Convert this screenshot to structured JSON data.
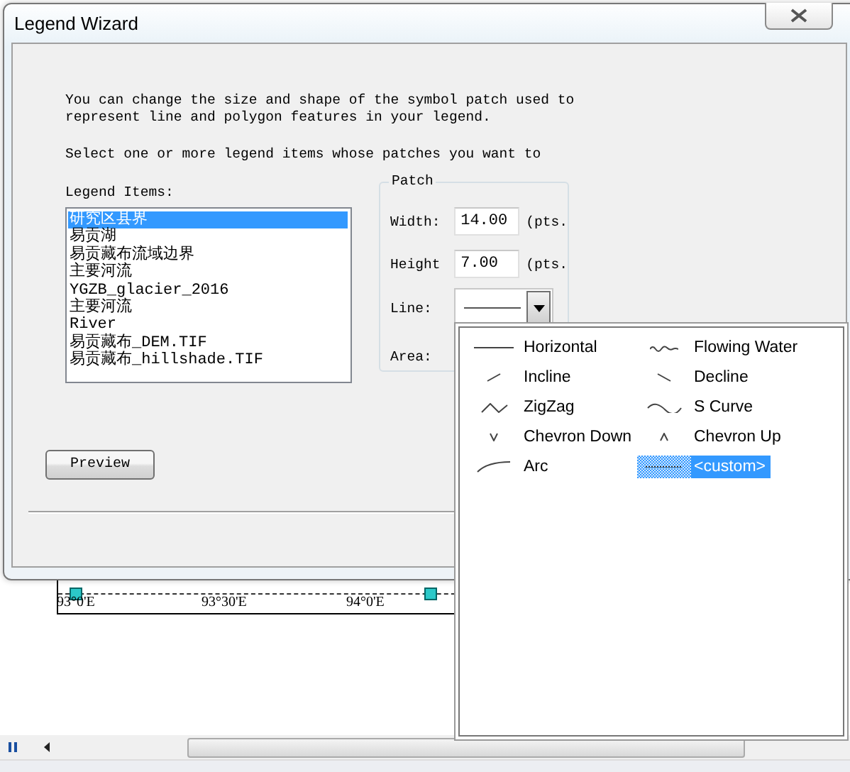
{
  "window": {
    "title": "Legend Wizard"
  },
  "intro_lines": [
    "You can change the size and shape of the symbol patch used to",
    "represent line and polygon features in your legend."
  ],
  "instruction": "Select one or more legend items whose patches you want to",
  "legend_items": {
    "label": "Legend Items:",
    "items": [
      {
        "text": "研究区县界",
        "selected": true
      },
      {
        "text": "易贡湖",
        "selected": false
      },
      {
        "text": "易贡藏布流域边界",
        "selected": false
      },
      {
        "text": "主要河流",
        "selected": false
      },
      {
        "text": "YGZB_glacier_2016",
        "selected": false
      },
      {
        "text": "主要河流",
        "selected": false
      },
      {
        "text": "River",
        "selected": false
      },
      {
        "text": "易贡藏布_DEM.TIF",
        "selected": false
      },
      {
        "text": "易贡藏布_hillshade.TIF",
        "selected": false
      }
    ]
  },
  "patch": {
    "title": "Patch",
    "fields": [
      {
        "label": "Width:",
        "value": "14.00",
        "unit": "(pts."
      },
      {
        "label": "Height",
        "value": "7.00",
        "unit": "(pts."
      }
    ],
    "line_label": "Line:",
    "area_label": "Area:"
  },
  "preview_button": "Preview",
  "line_menu": {
    "items": [
      {
        "label": "Horizontal",
        "kind": "horizontal",
        "selected": false
      },
      {
        "label": "Flowing Water",
        "kind": "flowing",
        "selected": false
      },
      {
        "label": "Incline",
        "kind": "incline",
        "selected": false
      },
      {
        "label": "Decline",
        "kind": "decline",
        "selected": false
      },
      {
        "label": "ZigZag",
        "kind": "zigzag",
        "selected": false
      },
      {
        "label": "S Curve",
        "kind": "scurve",
        "selected": false
      },
      {
        "label": "Chevron Down",
        "kind": "chevron_down",
        "selected": false
      },
      {
        "label": "Chevron Up",
        "kind": "chevron_up",
        "selected": false
      },
      {
        "label": "Arc",
        "kind": "arc",
        "selected": false
      },
      {
        "label": "<custom>",
        "kind": "custom",
        "selected": true
      }
    ]
  },
  "map": {
    "tick_labels": [
      "93°0'E",
      "93°30'E",
      "94°0'E"
    ]
  }
}
